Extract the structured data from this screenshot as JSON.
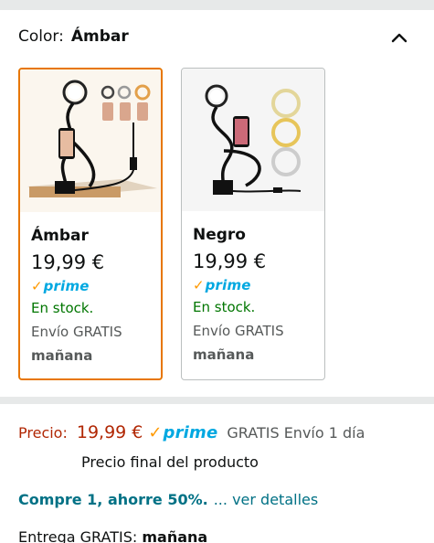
{
  "variation": {
    "label": "Color:",
    "selected_value": "Ámbar",
    "chevron_icon": "chevron-up-icon"
  },
  "swatches": [
    {
      "name": "Ámbar",
      "price": "19,99 €",
      "prime_check": "✓",
      "prime_label": "prime",
      "stock": "En stock.",
      "shipping": "Envío GRATIS",
      "shipping_day": "mañana",
      "selected": true,
      "image_icon": "ring-light-phone-holder-image"
    },
    {
      "name": "Negro",
      "price": "19,99 €",
      "prime_check": "✓",
      "prime_label": "prime",
      "stock": "En stock.",
      "shipping": "Envío GRATIS",
      "shipping_day": "mañana",
      "selected": false,
      "image_icon": "ring-light-phone-holder-image"
    }
  ],
  "buybox": {
    "price_label": "Precio:",
    "price": "19,99 €",
    "prime_check": "✓",
    "prime_label": "prime",
    "shipping": "GRATIS Envío 1 día",
    "final_price_note": "Precio final del producto",
    "promo_bold": "Compre 1, ahorre 50%.",
    "promo_link": "... ver detalles",
    "delivery_prefix": "Entrega GRATIS:",
    "delivery_day": "mañana"
  },
  "colors": {
    "accent_orange": "#e77600",
    "price_red": "#b12704",
    "prime_blue": "#00a8e1",
    "stock_green": "#007600",
    "link_teal": "#007185"
  }
}
